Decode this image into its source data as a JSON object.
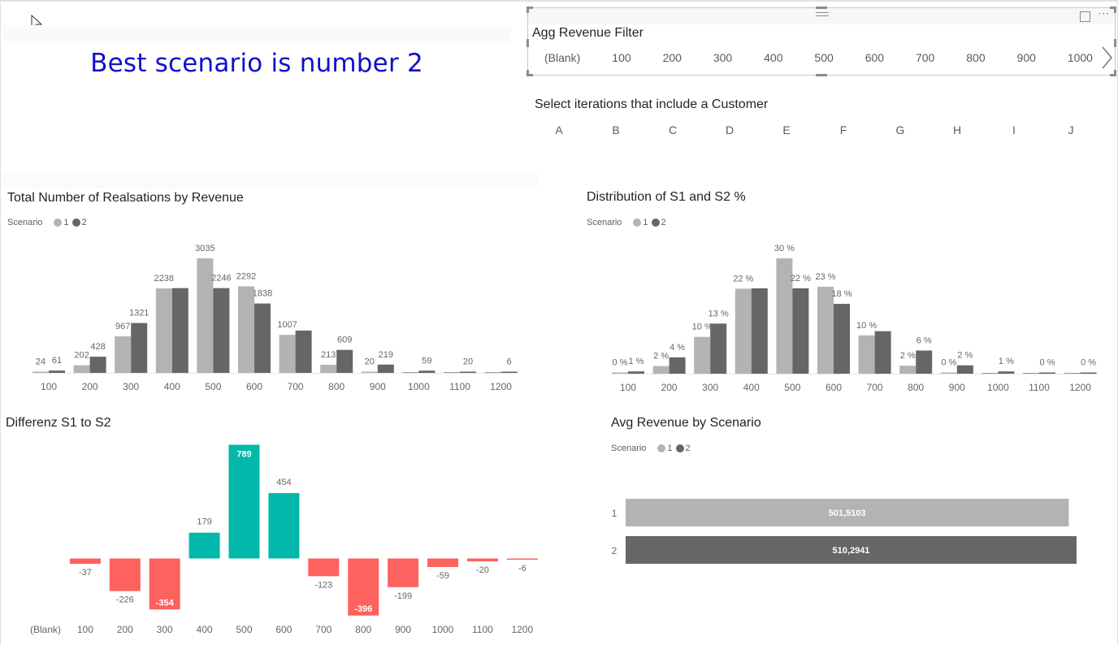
{
  "headline": "Best scenario is number 2",
  "colors": {
    "headline": "#1010c8",
    "scenario_1": "#b3b3b3",
    "scenario_2": "#666666",
    "positive": "#01b8aa",
    "negative": "#fd625e",
    "axis_text": "#666666",
    "label_text": "#666666"
  },
  "agg_revenue_filter": {
    "title": "Agg Revenue Filter",
    "items": [
      "(Blank)",
      "100",
      "200",
      "300",
      "400",
      "500",
      "600",
      "700",
      "800",
      "900",
      "1000"
    ],
    "next_icon": "chevron-right-icon",
    "header_icons": [
      "focus-mode-icon",
      "more-options-icon"
    ]
  },
  "customer_filter": {
    "title": "Select iterations that include a Customer",
    "items": [
      "A",
      "B",
      "C",
      "D",
      "E",
      "F",
      "G",
      "H",
      "I",
      "J"
    ]
  },
  "legend": {
    "title": "Scenario",
    "entries": [
      "1",
      "2"
    ]
  },
  "chart_data": [
    {
      "id": "realisations",
      "type": "bar",
      "title": "Total Number of Realsations by Revenue",
      "categories": [
        "100",
        "200",
        "300",
        "400",
        "500",
        "600",
        "700",
        "800",
        "900",
        "1000",
        "1100",
        "1200"
      ],
      "series": [
        {
          "name": "1",
          "values": [
            24,
            202,
            967,
            2238,
            3035,
            2292,
            1007,
            213,
            20,
            0,
            0,
            0
          ],
          "labels": [
            "24",
            "202",
            "967",
            "2238",
            "3035",
            "2292",
            "1007",
            "213",
            "20",
            "",
            "",
            ""
          ]
        },
        {
          "name": "2",
          "values": [
            61,
            428,
            1321,
            2246,
            2246,
            1838,
            1121,
            609,
            219,
            59,
            20,
            6
          ],
          "labels": [
            "61",
            "428",
            "1321",
            "",
            "2246",
            "1838",
            "",
            "609",
            "219",
            "59",
            "20",
            "6"
          ]
        }
      ],
      "xlabel": "",
      "ylabel": "",
      "ylim": [
        0,
        3035
      ],
      "legend": "top-left"
    },
    {
      "id": "distribution",
      "type": "bar",
      "title": "Distribution of S1 and S2 %",
      "categories": [
        "100",
        "200",
        "300",
        "400",
        "500",
        "600",
        "700",
        "800",
        "900",
        "1000",
        "1100",
        "1200"
      ],
      "series": [
        {
          "name": "1",
          "values": [
            0.3,
            2.0,
            9.7,
            22.4,
            30.4,
            22.9,
            10.1,
            2.1,
            0.2,
            0,
            0,
            0
          ],
          "labels": [
            "0 %",
            "2 %",
            "10 %",
            "22 %",
            "30 %",
            "23 %",
            "10 %",
            "2 %",
            "0 %",
            "",
            "",
            ""
          ]
        },
        {
          "name": "2",
          "values": [
            0.6,
            4.3,
            13.2,
            22.5,
            22.5,
            18.4,
            11.2,
            6.1,
            2.2,
            0.6,
            0.2,
            0.1
          ],
          "labels": [
            "1 %",
            "4 %",
            "13 %",
            "",
            "22 %",
            "18 %",
            "",
            "6 %",
            "2 %",
            "1 %",
            "0 %",
            "0 %"
          ]
        }
      ],
      "xlabel": "",
      "ylabel": "",
      "ylim": [
        0,
        30.4
      ],
      "legend": "top-left"
    },
    {
      "id": "differenz",
      "type": "bar",
      "title": "Differenz S1 to S2",
      "categories": [
        "(Blank)",
        "100",
        "200",
        "300",
        "400",
        "500",
        "600",
        "700",
        "800",
        "900",
        "1000",
        "1100",
        "1200"
      ],
      "values": [
        null,
        -37,
        -226,
        -354,
        179,
        789,
        454,
        -123,
        -396,
        -199,
        -59,
        -20,
        -6
      ],
      "labels": [
        "",
        "-37",
        "-226",
        "-354",
        "179",
        "789",
        "454",
        "-123",
        "-396",
        "-199",
        "-59",
        "-20",
        "-6"
      ],
      "inside_labels": [
        "-354",
        "789",
        "-396"
      ],
      "xlabel": "",
      "ylabel": "",
      "ylim": [
        -396,
        789
      ]
    },
    {
      "id": "avg_revenue",
      "type": "bar",
      "orientation": "horizontal",
      "title": "Avg Revenue by Scenario",
      "categories": [
        "1",
        "2"
      ],
      "values": [
        501.5103,
        510.2941
      ],
      "labels": [
        "501,5103",
        "510,2941"
      ],
      "xlim": [
        0,
        510.2941
      ],
      "legend": "top-left"
    }
  ]
}
